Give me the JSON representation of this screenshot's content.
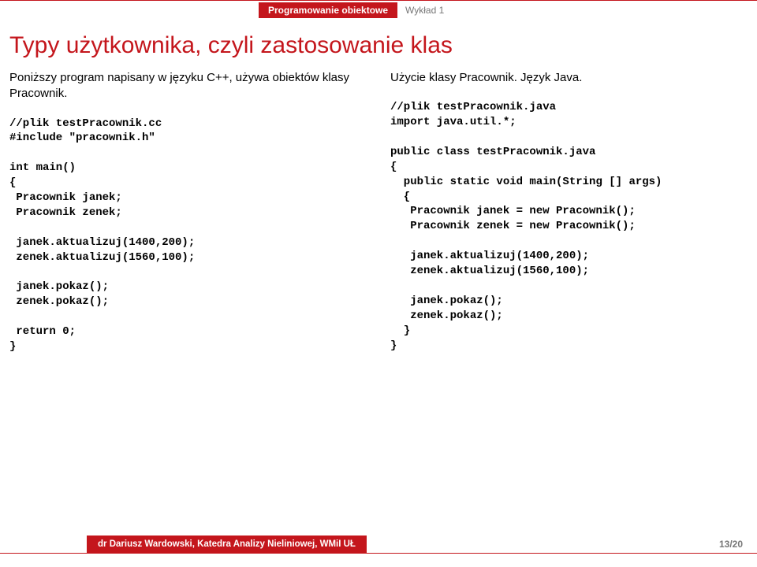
{
  "header": {
    "red": "Programowanie obiektowe",
    "gray": "Wykład 1"
  },
  "title": "Typy użytkownika, czyli zastosowanie klas",
  "left": {
    "para": "Poniższy program napisany w języku C++, używa obiektów klasy Pracownik.",
    "code": "//plik testPracownik.cc\n#include \"pracownik.h\"\n\nint main()\n{\n Pracownik janek;\n Pracownik zenek;\n\n janek.aktualizuj(1400,200);\n zenek.aktualizuj(1560,100);\n\n janek.pokaz();\n zenek.pokaz();\n\n return 0;\n}"
  },
  "right": {
    "para": "Użycie klasy Pracownik. Język Java.",
    "code": "//plik testPracownik.java\nimport java.util.*;\n\npublic class testPracownik.java\n{\n  public static void main(String [] args)\n  {\n   Pracownik janek = new Pracownik();\n   Pracownik zenek = new Pracownik();\n\n   janek.aktualizuj(1400,200);\n   zenek.aktualizuj(1560,100);\n\n   janek.pokaz();\n   zenek.pokaz();\n  }\n}"
  },
  "footer": {
    "author": "dr Dariusz Wardowski, Katedra Analizy Nieliniowej, WMiI UŁ",
    "page": "13/20"
  }
}
